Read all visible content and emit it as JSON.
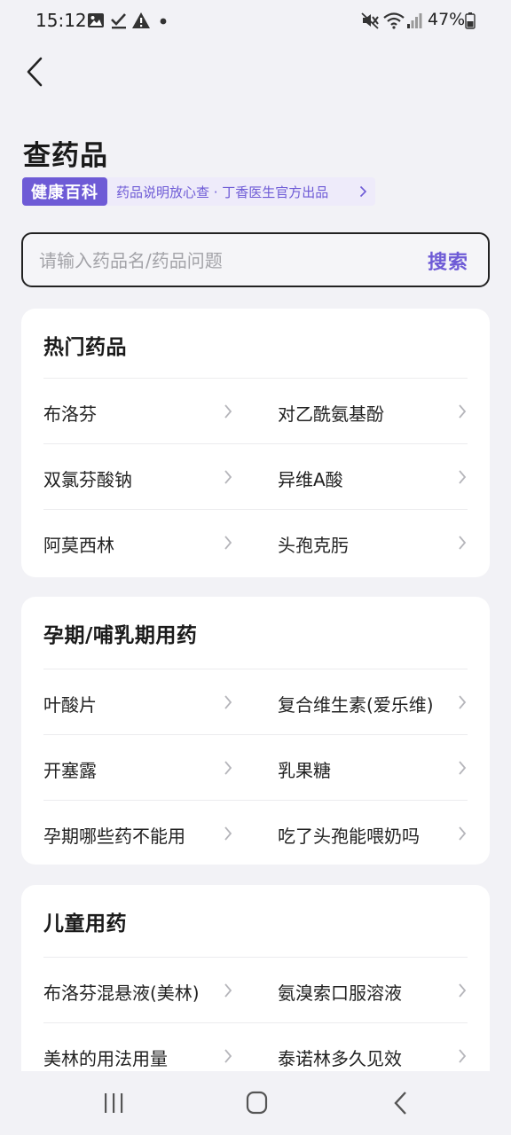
{
  "status_bar": {
    "time": "15:12",
    "battery_percent": "47%",
    "icons_left": [
      "image-icon",
      "check-icon",
      "warning-icon",
      "dot-icon"
    ],
    "icons_right": [
      "mute-icon",
      "wifi-icon",
      "signal-icon",
      "battery-icon"
    ]
  },
  "header": {
    "title": "查药品",
    "brand_badge": "健康百科",
    "brand_text": "药品说明放心查 · 丁香医生官方出品"
  },
  "search": {
    "placeholder": "请输入药品名/药品问题",
    "value": "",
    "button_label": "搜索"
  },
  "sections": [
    {
      "title": "热门药品",
      "items": [
        "布洛芬",
        "对乙酰氨基酚",
        "双氯芬酸钠",
        "异维A酸",
        "阿莫西林",
        "头孢克肟"
      ]
    },
    {
      "title": "孕期/哺乳期用药",
      "items": [
        "叶酸片",
        "复合维生素(爱乐维)",
        "开塞露",
        "乳果糖",
        "孕期哪些药不能用",
        "吃了头孢能喂奶吗"
      ]
    },
    {
      "title": "儿童用药",
      "items": [
        "布洛芬混悬液(美林)",
        "氨溴索口服溶液",
        "美林的用法用量",
        "泰诺林多久见效"
      ]
    }
  ],
  "colors": {
    "accent": "#6e5bd6",
    "background": "#f2f2f6",
    "card": "#ffffff"
  }
}
